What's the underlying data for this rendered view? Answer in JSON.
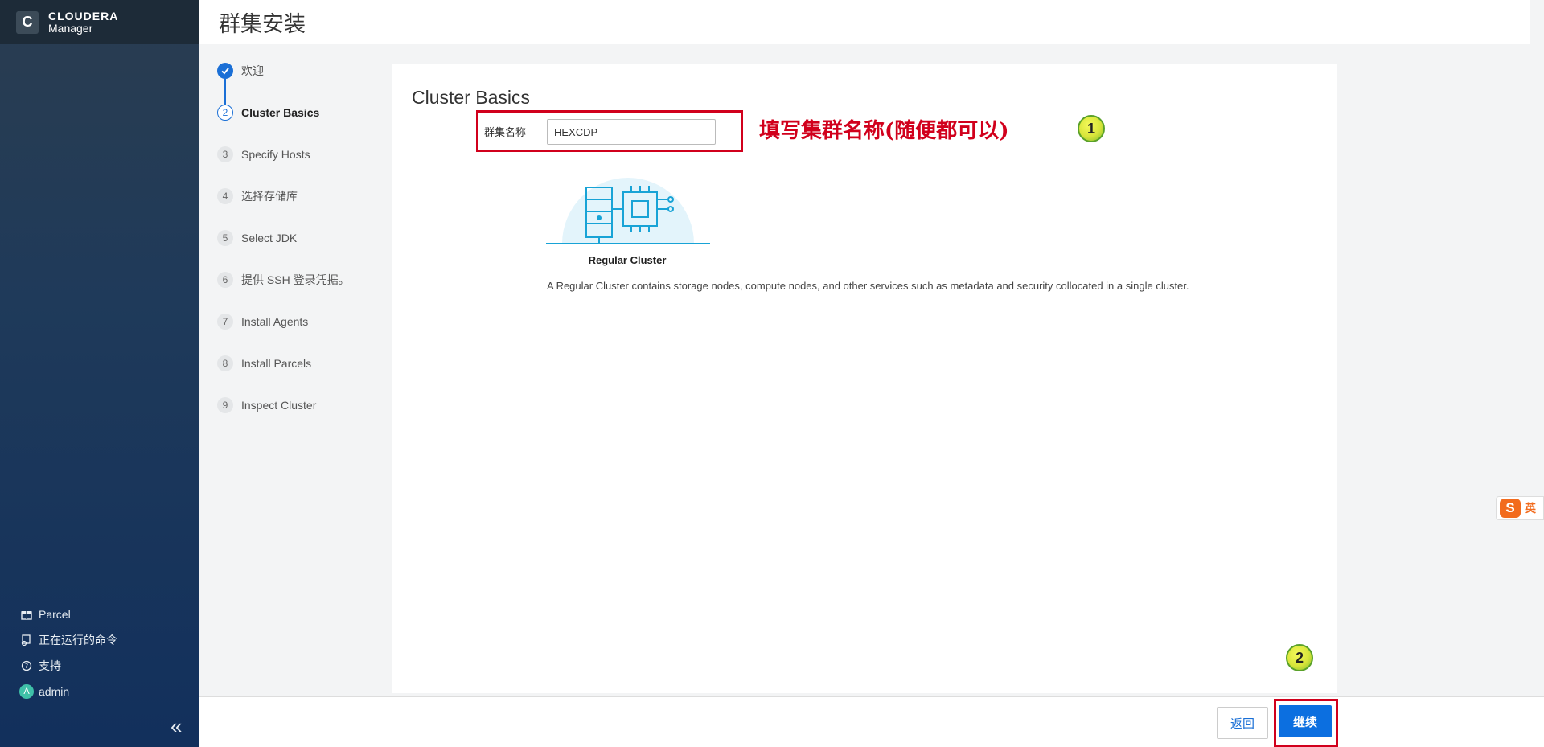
{
  "brand": {
    "name": "CLOUDERA",
    "sub": "Manager",
    "logo_letter": "C"
  },
  "header": {
    "title": "群集安装"
  },
  "steps": [
    {
      "num": "",
      "label": "欢迎",
      "state": "done"
    },
    {
      "num": "2",
      "label": "Cluster Basics",
      "state": "active"
    },
    {
      "num": "3",
      "label": "Specify Hosts",
      "state": "pending"
    },
    {
      "num": "4",
      "label": "选择存储库",
      "state": "pending"
    },
    {
      "num": "5",
      "label": "Select JDK",
      "state": "pending"
    },
    {
      "num": "6",
      "label": "提供 SSH 登录凭据。",
      "state": "pending"
    },
    {
      "num": "7",
      "label": "Install Agents",
      "state": "pending"
    },
    {
      "num": "8",
      "label": "Install Parcels",
      "state": "pending"
    },
    {
      "num": "9",
      "label": "Inspect Cluster",
      "state": "pending"
    }
  ],
  "panel": {
    "title": "Cluster Basics",
    "field_label": "群集名称",
    "field_value": "HEXCDP",
    "cluster_name": "Regular Cluster",
    "cluster_desc": "A Regular Cluster contains storage nodes, compute nodes, and other services such as metadata and security collocated in a single cluster."
  },
  "annotations": {
    "note": "填写集群名称(随便都可以)",
    "badge1": "1",
    "badge2": "2"
  },
  "sidebar": {
    "items": [
      {
        "label": "Parcel",
        "icon": "gift-icon"
      },
      {
        "label": "正在运行的命令",
        "icon": "running-commands-icon"
      },
      {
        "label": "支持",
        "icon": "help-icon"
      },
      {
        "label": "admin",
        "icon": "avatar",
        "avatar_letter": "A"
      }
    ],
    "collapse": "«"
  },
  "footer": {
    "back_label": "返回",
    "next_label": "继续"
  },
  "ime": {
    "logo": "S",
    "mode": "英"
  },
  "colors": {
    "accent": "#0c6fe0",
    "annotation": "#d1001c",
    "sidebar": "#1f3a5a"
  }
}
